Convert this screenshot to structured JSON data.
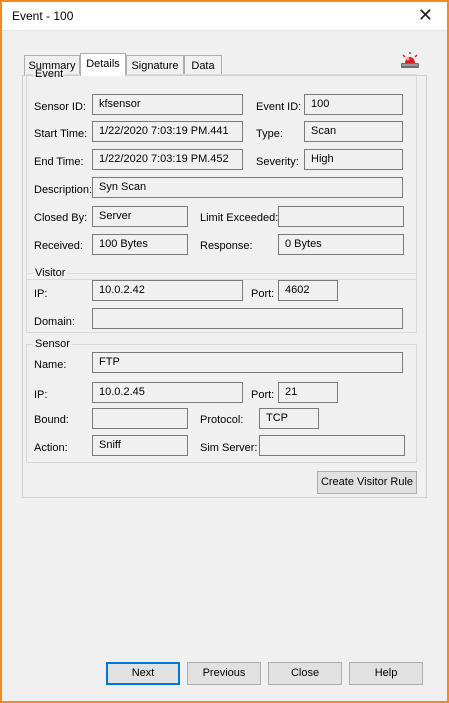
{
  "window": {
    "title": "Event - 100",
    "close_glyph": "✕"
  },
  "tabs": [
    {
      "label": "Summary"
    },
    {
      "label": "Details"
    },
    {
      "label": "Signature"
    },
    {
      "label": "Data"
    }
  ],
  "icons": {
    "alarm": "alarm-siren-icon"
  },
  "event": {
    "legend": "Event",
    "sensor_id_label": "Sensor ID:",
    "sensor_id": "kfsensor",
    "event_id_label": "Event ID:",
    "event_id": "100",
    "start_time_label": "Start Time:",
    "start_time": "1/22/2020 7:03:19 PM.441",
    "type_label": "Type:",
    "type": "Scan",
    "end_time_label": "End Time:",
    "end_time": "1/22/2020 7:03:19 PM.452",
    "severity_label": "Severity:",
    "severity": "High",
    "description_label": "Description:",
    "description": "Syn Scan",
    "closed_by_label": "Closed By:",
    "closed_by": "Server",
    "limit_exceeded_label": "Limit Exceeded:",
    "limit_exceeded": "",
    "received_label": "Received:",
    "received": "100 Bytes",
    "response_label": "Response:",
    "response": "0 Bytes"
  },
  "visitor": {
    "legend": "Visitor",
    "ip_label": "IP:",
    "ip": "10.0.2.42",
    "port_label": "Port:",
    "port": "4602",
    "domain_label": "Domain:",
    "domain": ""
  },
  "sensor": {
    "legend": "Sensor",
    "name_label": "Name:",
    "name": "FTP",
    "ip_label": "IP:",
    "ip": "10.0.2.45",
    "port_label": "Port:",
    "port": "21",
    "bound_label": "Bound:",
    "bound": "",
    "protocol_label": "Protocol:",
    "protocol": "TCP",
    "action_label": "Action:",
    "action": "Sniff",
    "sim_server_label": "Sim Server:",
    "sim_server": ""
  },
  "buttons": {
    "create_visitor_rule": "Create Visitor Rule",
    "next": "Next",
    "previous": "Previous",
    "close": "Close",
    "help": "Help"
  },
  "colors": {
    "window_border": "#f28a1e",
    "focus": "#0078d7",
    "dialog_bg": "#f0f0f0"
  }
}
